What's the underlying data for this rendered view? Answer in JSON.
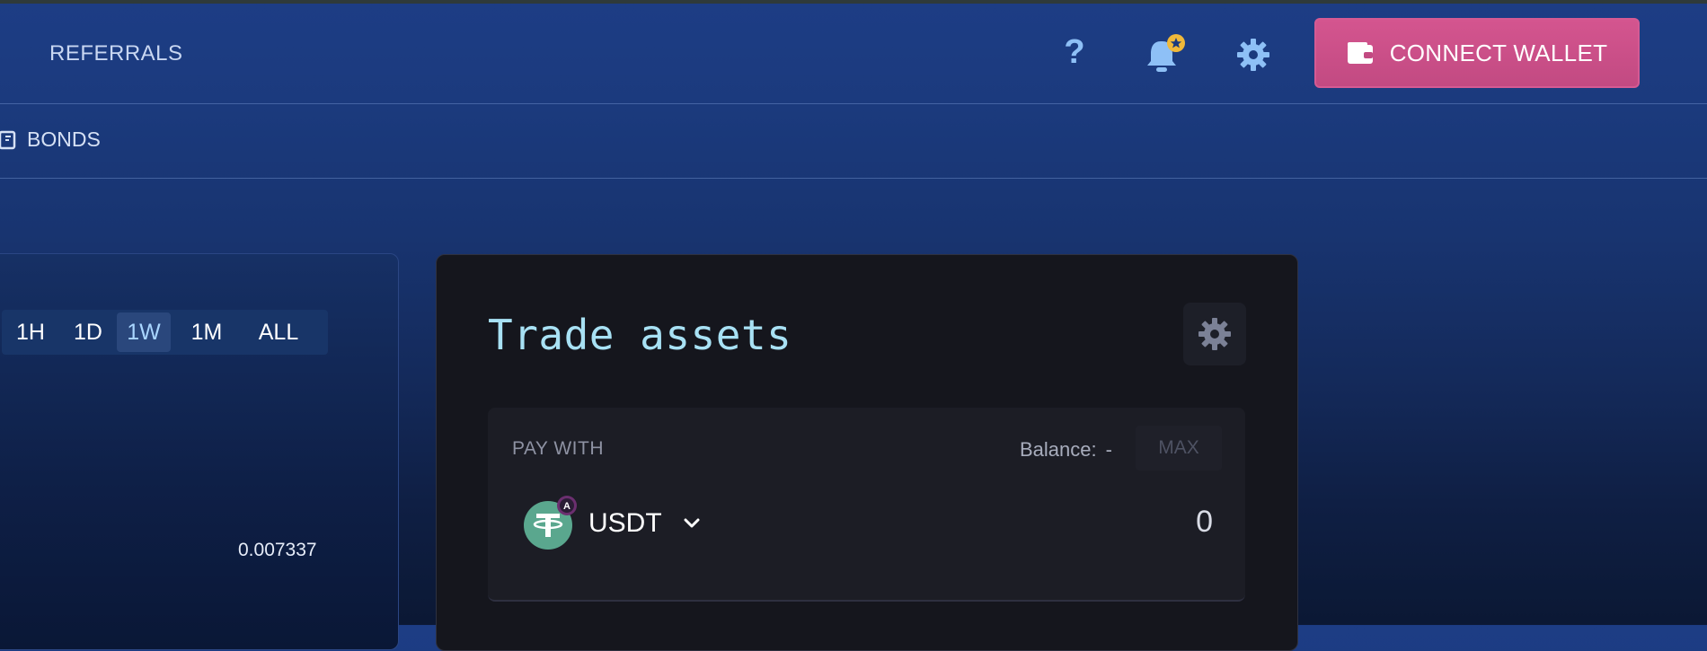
{
  "header": {
    "nav_referrals": "REFERRALS",
    "help_icon": "?",
    "connect_wallet_label": "CONNECT WALLET"
  },
  "subnav": {
    "bonds_label": "BONDS"
  },
  "chart": {
    "ranges": [
      "1H",
      "1D",
      "1W",
      "1M",
      "ALL"
    ],
    "active_range": "1W",
    "value_label": "0.007337"
  },
  "trade": {
    "title": "Trade assets",
    "pay_with_label": "PAY WITH",
    "balance_label": "Balance:",
    "balance_value": "-",
    "max_label": "MAX",
    "token_symbol": "USDT",
    "token_badge": "A",
    "amount": "0"
  },
  "icons": [
    "help-icon",
    "bell-icon",
    "gear-icon",
    "wallet-icon",
    "bonds-icon",
    "chevron-down-icon",
    "usdt-icon"
  ],
  "colors": {
    "accent_pink": "#c24a82",
    "title_cyan": "#a8e1f4",
    "active_range": "#a9d6ff"
  }
}
